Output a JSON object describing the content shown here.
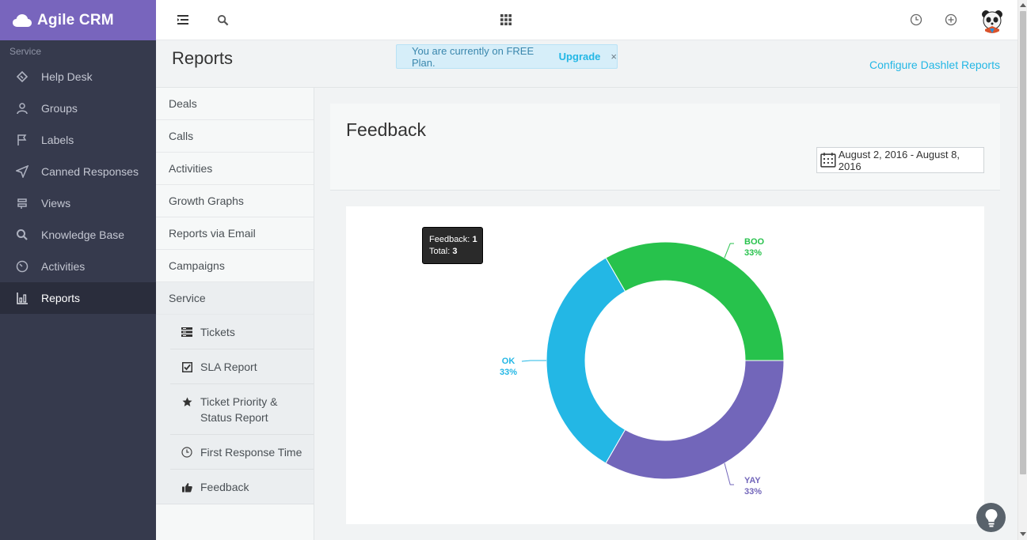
{
  "brand": {
    "name": "Agile CRM"
  },
  "sidebar": {
    "section_label": "Service",
    "items": [
      {
        "label": "Help Desk",
        "icon": "ticket-icon"
      },
      {
        "label": "Groups",
        "icon": "users-icon"
      },
      {
        "label": "Labels",
        "icon": "flag-icon"
      },
      {
        "label": "Canned Responses",
        "icon": "paper-plane-icon"
      },
      {
        "label": "Views",
        "icon": "signpost-icon"
      },
      {
        "label": "Knowledge Base",
        "icon": "search-icon"
      },
      {
        "label": "Activities",
        "icon": "gauge-icon"
      },
      {
        "label": "Reports",
        "icon": "bar-chart-icon",
        "active": true
      }
    ]
  },
  "topbar": {
    "icons": [
      "menu-toggle-icon",
      "search-icon",
      "apps-grid-icon",
      "clock-icon",
      "add-circle-icon",
      "user-avatar"
    ]
  },
  "page": {
    "title": "Reports",
    "banner": {
      "text": "You are currently on FREE Plan.",
      "link": "Upgrade",
      "close": "×"
    },
    "configure_link": "Configure Dashlet Reports"
  },
  "report_menu": {
    "items": [
      "Deals",
      "Calls",
      "Activities",
      "Growth Graphs",
      "Reports via Email",
      "Campaigns",
      "Service"
    ],
    "service_sub": [
      {
        "label": "Tickets",
        "icon": "tickets-icon"
      },
      {
        "label": "SLA Report",
        "icon": "checkbox-icon"
      },
      {
        "label": "Ticket Priority & Status Report",
        "icon": "star-icon"
      },
      {
        "label": "First Response Time",
        "icon": "clock-icon"
      },
      {
        "label": "Feedback",
        "icon": "thumbs-up-icon"
      }
    ]
  },
  "card": {
    "title": "Feedback",
    "date_range": "August 2, 2016 - August 8, 2016"
  },
  "tooltip": {
    "line1_label": "Feedback:",
    "line1_value": "1",
    "line2_label": "Total:",
    "line2_value": "3"
  },
  "chart_data": {
    "type": "pie",
    "donut": true,
    "series": [
      {
        "name": "BOO",
        "value": 1,
        "percent_label": "33%",
        "color": "#27c24c"
      },
      {
        "name": "YAY",
        "value": 1,
        "percent_label": "33%",
        "color": "#7266ba"
      },
      {
        "name": "OK",
        "value": 1,
        "percent_label": "33%",
        "color": "#23b7e5"
      }
    ]
  },
  "colors": {
    "brand": "#7865bd",
    "sidebar": "#363a4d",
    "accent": "#23b7e5"
  }
}
